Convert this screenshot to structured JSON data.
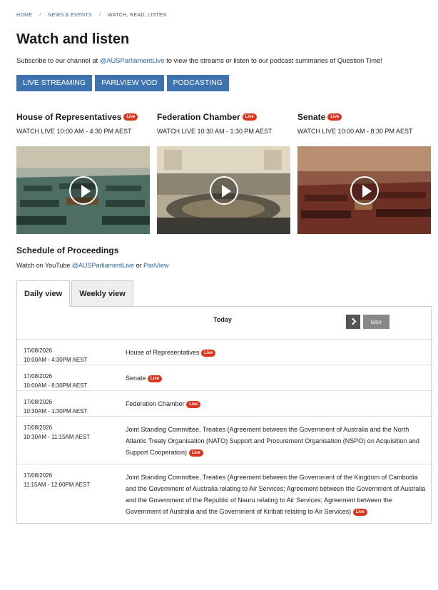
{
  "breadcrumb": {
    "home": "HOME",
    "news": "NEWS & EVENTS",
    "current": "WATCH, READ, LISTEN",
    "separator": "/"
  },
  "page_title": "Watch and listen",
  "intro": {
    "before": "Subscribe to our channel at ",
    "link": "@AUSParliamentLive",
    "after": " to view the streams or listen to our podcast summaries of Question Time!"
  },
  "buttons": {
    "live_streaming": "LIVE STREAMING",
    "parlview_vod": "PARLVIEW VOD",
    "podcasting": "PODCASTING"
  },
  "live_badge": "Live",
  "streams": [
    {
      "title": "House of Representatives",
      "time": "WATCH LIVE 10:00 AM - 4:30 PM AEST"
    },
    {
      "title": "Federation Chamber",
      "time": "WATCH LIVE 10:30 AM - 1:30 PM AEST"
    },
    {
      "title": "Senate",
      "time": "WATCH LIVE 10:00 AM - 8:30 PM AEST"
    }
  ],
  "schedule": {
    "title": "Schedule of Proceedings",
    "watch_prefix": "Watch on YouTube ",
    "youtube_link": "@AUSParliamentLive",
    "or": " or ",
    "parlview_link": "ParlView",
    "tabs": [
      "Daily view",
      "Weekly view"
    ],
    "day_label": "Today",
    "later_label": "later",
    "rows": [
      {
        "date": "17/08/2026",
        "time": "10:00AM - 4:30PM AEST",
        "desc": "House of Representatives"
      },
      {
        "date": "17/08/2026",
        "time": "10:00AM - 8:30PM AEST",
        "desc": "Senate"
      },
      {
        "date": "17/08/2026",
        "time": "10:30AM - 1:30PM AEST",
        "desc": "Federation Chamber"
      },
      {
        "date": "17/08/2026",
        "time": "10:30AM - 11:15AM AEST",
        "desc": "Joint Standing Committee, Treaties (Agreement between the Government of Australia and the North Atlantic Treaty Organisation (NATO) Support and Procurement Organisation (NSPO) on Acquisition and Support Cooperation)"
      },
      {
        "date": "17/08/2026",
        "time": "11:15AM - 12:00PM AEST",
        "desc": "Joint Standing Committee, Treaties (Agreement between the Government of the Kingdom of Cambodia and the Government of Australia relating to Air Services; Agreement between the Government of Australia and the Government of the Republic of Nauru relating to Air Services; Agreement between the Government of Australia and the Government of Kiribati relating to Air Services)"
      }
    ]
  },
  "colors": {
    "primary_button": "#3f73b0",
    "live_badge": "#d9351f",
    "link": "#2a66a8"
  },
  "icons": {
    "play": "play-icon",
    "next": "chevron-right-icon"
  }
}
